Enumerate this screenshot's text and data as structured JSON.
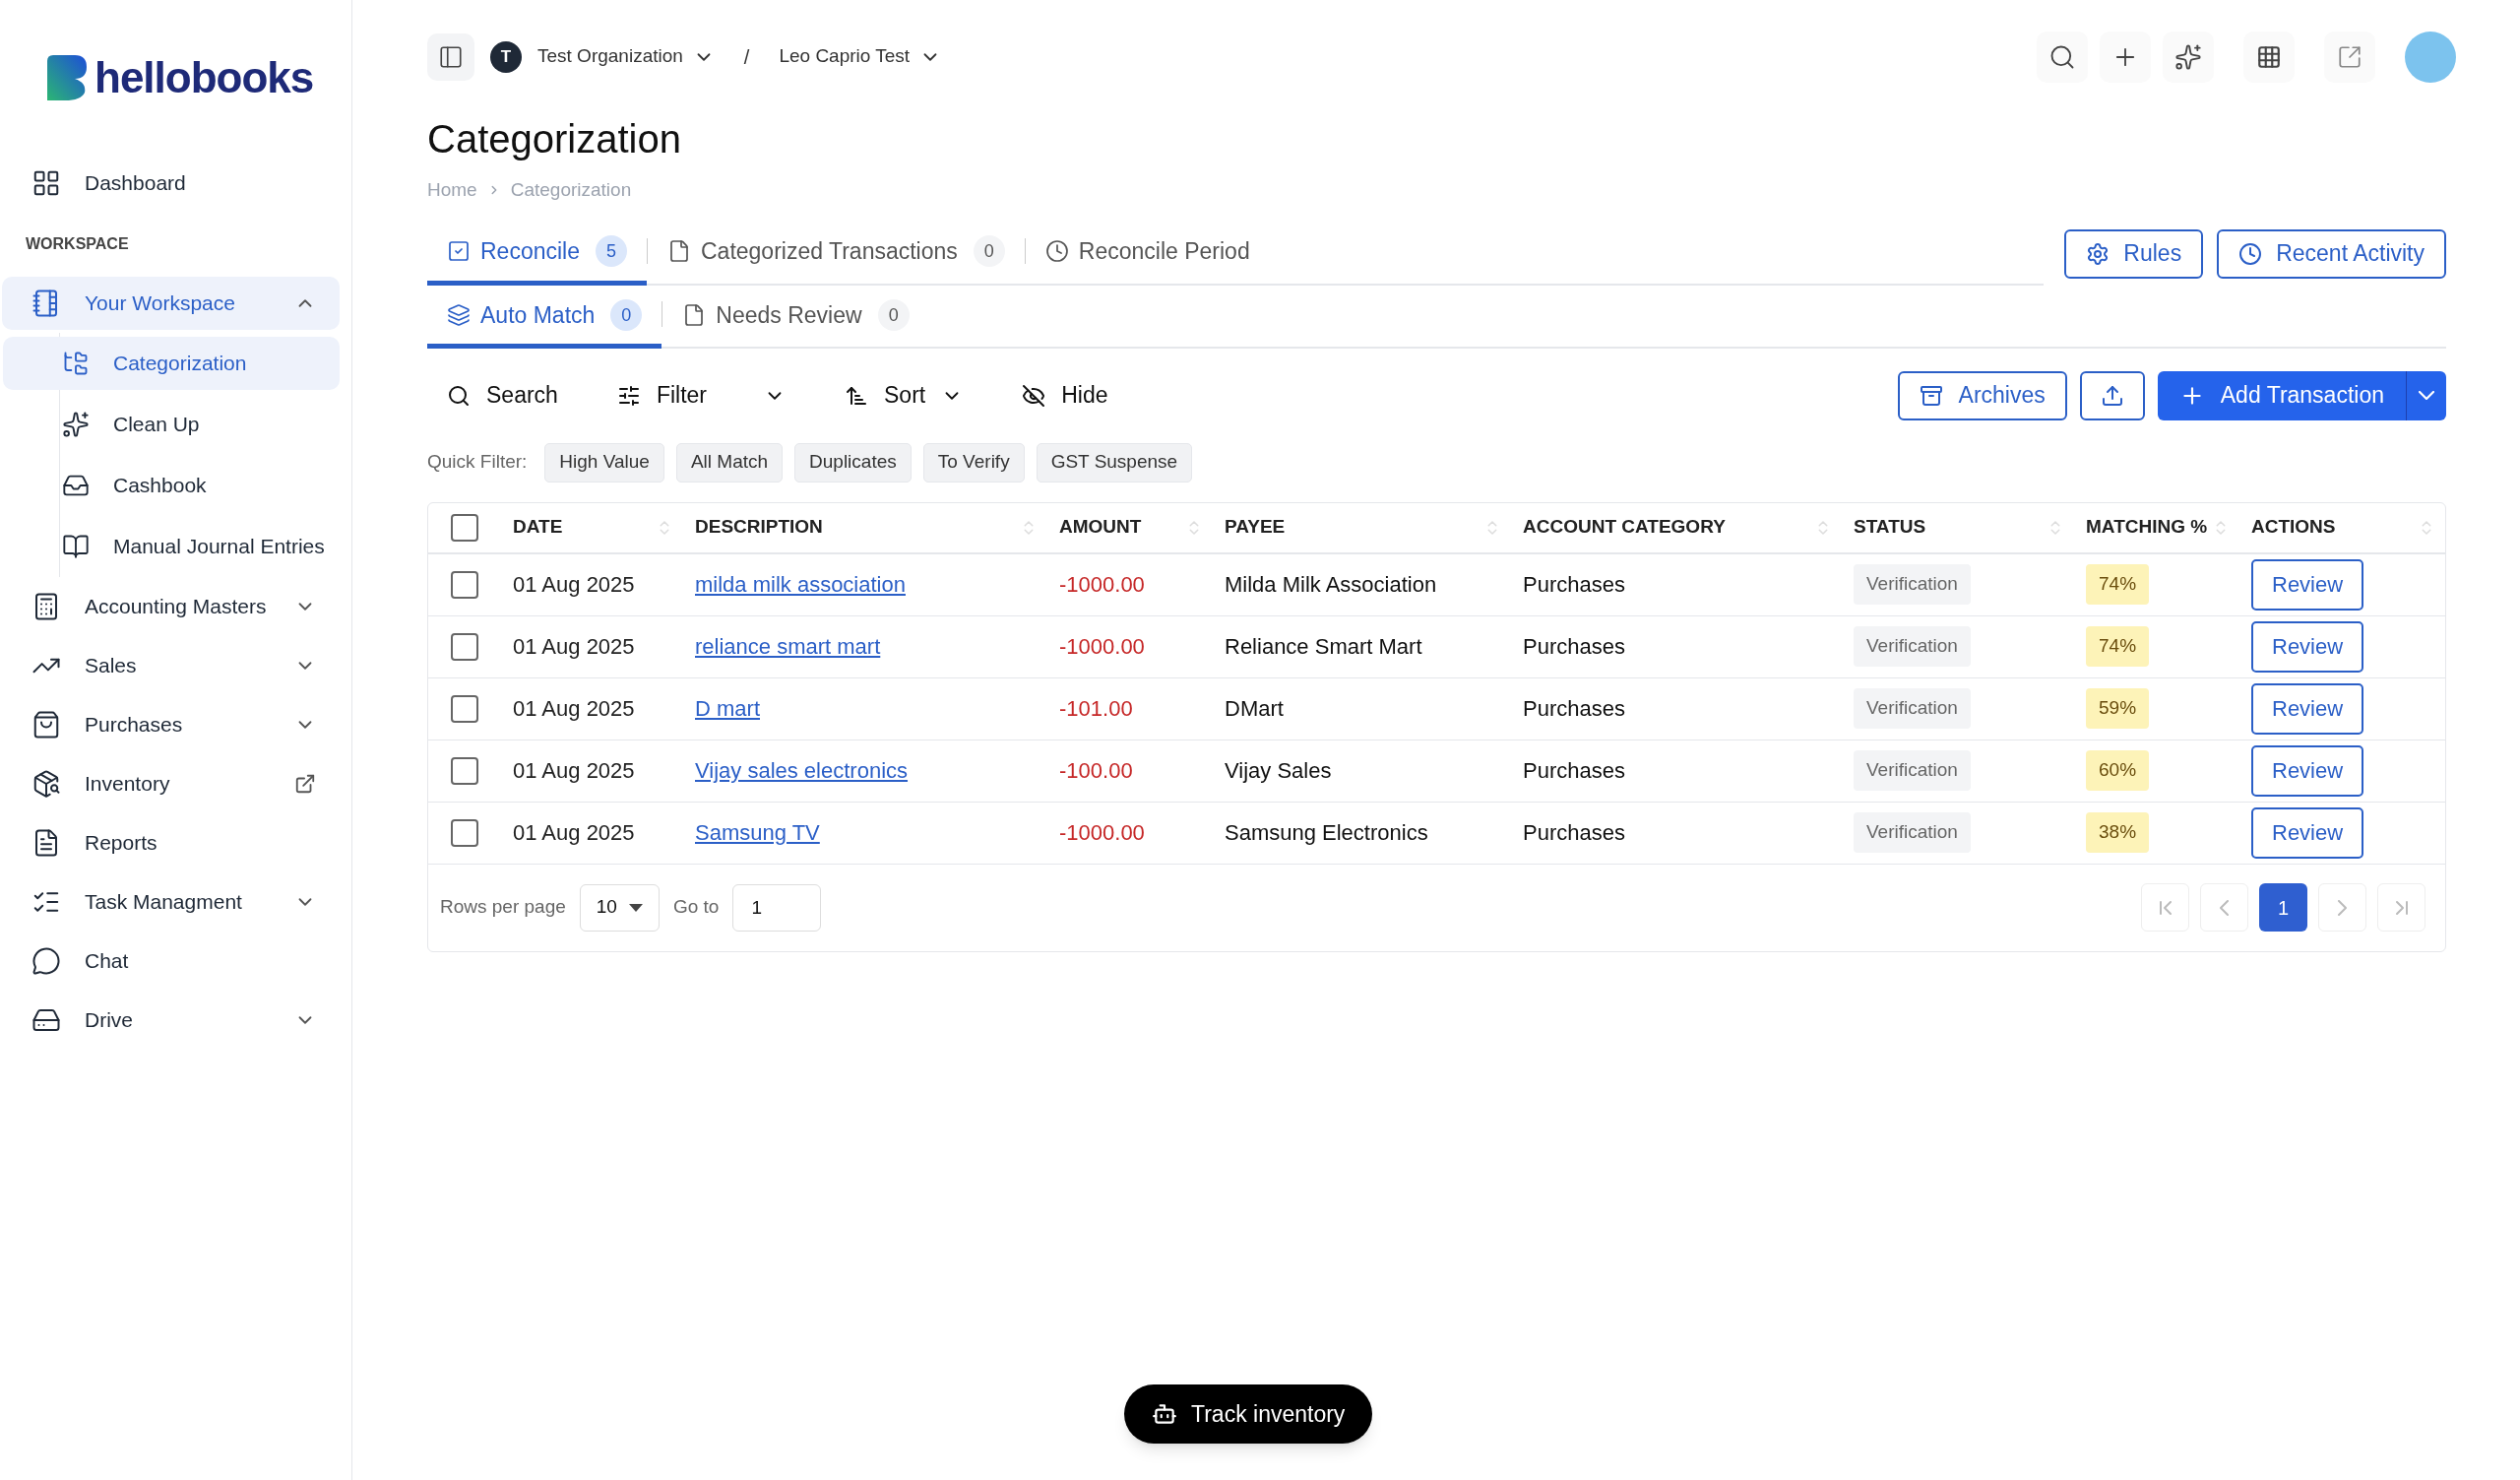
{
  "logo": {
    "text": "hellobooks"
  },
  "sidebar": {
    "items": [
      {
        "kind": "link",
        "label": "Dashboard",
        "selected": false
      },
      {
        "kind": "heading",
        "label": "WORKSPACE"
      },
      {
        "kind": "group",
        "label": "Your Workspace",
        "selected": true,
        "expanded": true,
        "children": [
          {
            "label": "Categorization",
            "selected": true
          },
          {
            "label": "Clean Up",
            "selected": false
          },
          {
            "label": "Cashbook",
            "selected": false
          },
          {
            "label": "Manual Journal Entries",
            "selected": false
          }
        ]
      },
      {
        "kind": "group",
        "label": "Accounting Masters",
        "selected": false,
        "expanded": false
      },
      {
        "kind": "group",
        "label": "Sales",
        "selected": false,
        "expanded": false
      },
      {
        "kind": "group",
        "label": "Purchases",
        "selected": false,
        "expanded": false
      },
      {
        "kind": "external",
        "label": "Inventory",
        "selected": false
      },
      {
        "kind": "link",
        "label": "Reports",
        "selected": false
      },
      {
        "kind": "group",
        "label": "Task Managment",
        "selected": false,
        "expanded": false
      },
      {
        "kind": "link",
        "label": "Chat",
        "selected": false
      },
      {
        "kind": "group",
        "label": "Drive",
        "selected": false,
        "expanded": false
      }
    ]
  },
  "topbar": {
    "org_initial": "T",
    "org": "Test Organization",
    "separator": "/",
    "project": "Leo Caprio Test"
  },
  "page": {
    "title": "Categorization",
    "breadcrumb": [
      "Home",
      "Categorization"
    ]
  },
  "tabs": [
    {
      "label": "Reconcile",
      "count": "5",
      "selected": true
    },
    {
      "label": "Categorized Transactions",
      "count": "0",
      "selected": false
    },
    {
      "label": "Reconcile Period",
      "selected": false
    }
  ],
  "header_buttons": [
    "Rules",
    "Recent Activity"
  ],
  "subtabs": [
    {
      "label": "Auto Match",
      "count": "0",
      "selected": true
    },
    {
      "label": "Needs Review",
      "count": "0",
      "selected": false
    }
  ],
  "toolbar": {
    "search": "Search",
    "filter": "Filter",
    "sort": "Sort",
    "hide": "Hide",
    "archives": "Archives",
    "add": "Add Transaction"
  },
  "quick_filter": {
    "label": "Quick Filter:",
    "chips": [
      "High Value",
      "All Match",
      "Duplicates",
      "To Verify",
      "GST Suspense"
    ]
  },
  "table": {
    "all_checked": false,
    "columns": [
      "DATE",
      "DESCRIPTION",
      "AMOUNT",
      "PAYEE",
      "ACCOUNT CATEGORY",
      "STATUS",
      "MATCHING %",
      "ACTIONS"
    ],
    "rows": [
      {
        "checked": false,
        "date": "01 Aug 2025",
        "description": "milda milk association",
        "amount": "-1000.00",
        "payee": "Milda Milk Association",
        "category": "Purchases",
        "status": "Verification",
        "matching": "74%",
        "action": "Review"
      },
      {
        "checked": false,
        "date": "01 Aug 2025",
        "description": "reliance smart mart",
        "amount": "-1000.00",
        "payee": "Reliance Smart Mart",
        "category": "Purchases",
        "status": "Verification",
        "matching": "74%",
        "action": "Review"
      },
      {
        "checked": false,
        "date": "01 Aug 2025",
        "description": "D mart",
        "amount": "-101.00",
        "payee": "DMart",
        "category": "Purchases",
        "status": "Verification",
        "matching": "59%",
        "action": "Review"
      },
      {
        "checked": false,
        "date": "01 Aug 2025",
        "description": "Vijay sales electronics",
        "amount": "-100.00",
        "payee": "Vijay Sales",
        "category": "Purchases",
        "status": "Verification",
        "matching": "60%",
        "action": "Review"
      },
      {
        "checked": false,
        "date": "01 Aug 2025",
        "description": "Samsung TV",
        "amount": "-1000.00",
        "payee": "Samsung Electronics",
        "category": "Purchases",
        "status": "Verification",
        "matching": "38%",
        "action": "Review"
      }
    ]
  },
  "pagination": {
    "rows_label": "Rows per page",
    "rows_value": "10",
    "goto_label": "Go to",
    "goto_value": "1",
    "pages": [
      {
        "label": "1",
        "selected": true
      }
    ]
  },
  "toast": {
    "text": "Track inventory"
  }
}
